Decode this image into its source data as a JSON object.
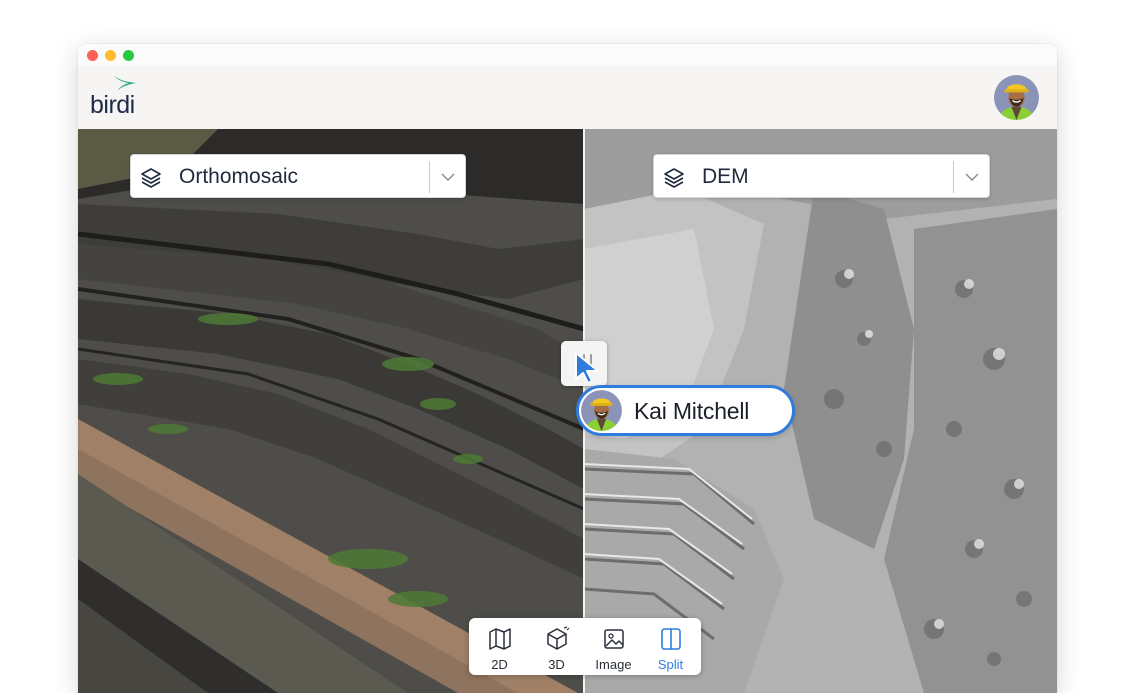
{
  "window": {
    "controls": [
      "close",
      "minimize",
      "maximize"
    ]
  },
  "app": {
    "logo_text": "birdi",
    "brand_color": "#1fa87a"
  },
  "user": {
    "avatar": "user-avatar"
  },
  "viewer": {
    "left_layer": {
      "label": "Orthomosaic",
      "icon": "layers-icon"
    },
    "right_layer": {
      "label": "DEM",
      "icon": "layers-icon"
    },
    "collaborator": {
      "name": "Kai Mitchell",
      "accent": "#2f7bde"
    }
  },
  "view_modes": [
    {
      "label": "2D",
      "icon": "map-icon",
      "active": false
    },
    {
      "label": "3D",
      "icon": "cube-icon",
      "active": false
    },
    {
      "label": "Image",
      "icon": "image-icon",
      "active": false
    },
    {
      "label": "Split",
      "icon": "split-icon",
      "active": true
    }
  ]
}
